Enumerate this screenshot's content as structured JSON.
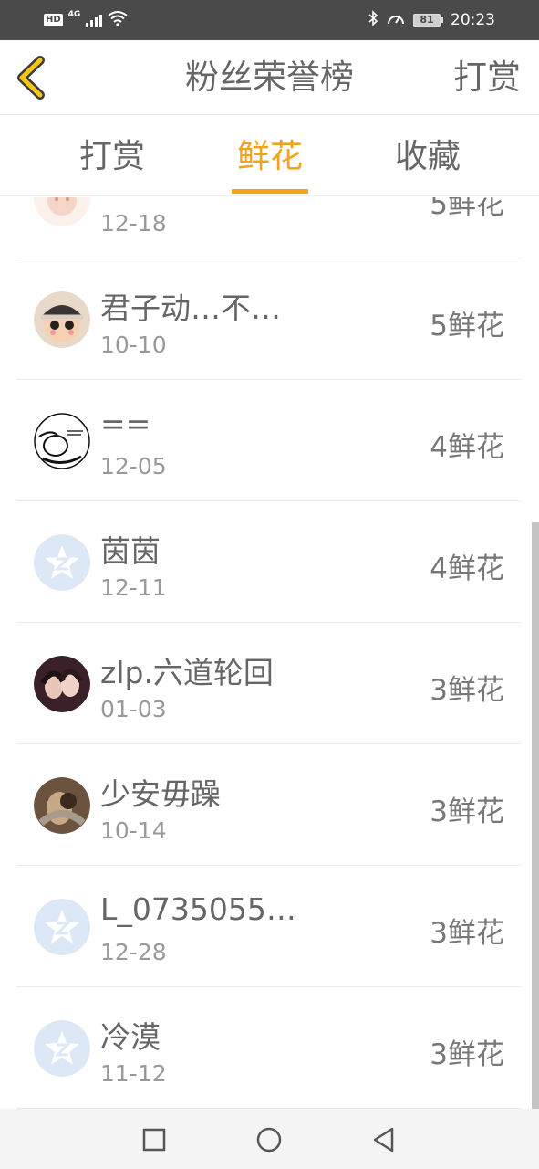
{
  "status_bar": {
    "hd": "HD",
    "network": "4G",
    "battery": "81",
    "time": "20:23"
  },
  "header": {
    "title": "粉丝荣誉榜",
    "action": "打赏"
  },
  "tabs": [
    {
      "label": "打赏",
      "active": false
    },
    {
      "label": "鲜花",
      "active": true
    },
    {
      "label": "收藏",
      "active": false
    }
  ],
  "fans": [
    {
      "name": "",
      "date": "12-18",
      "flowers": "5鲜花",
      "avatar": "doll-pink"
    },
    {
      "name": "君子动…不…",
      "date": "10-10",
      "flowers": "5鲜花",
      "avatar": "doll-hat"
    },
    {
      "name": "==",
      "date": "12-05",
      "flowers": "4鲜花",
      "avatar": "sketch"
    },
    {
      "name": "茵茵",
      "date": "12-11",
      "flowers": "4鲜花",
      "avatar": "qq-default"
    },
    {
      "name": "zlp.六道轮回",
      "date": "01-03",
      "flowers": "3鲜花",
      "avatar": "photo-girls"
    },
    {
      "name": "少安毋躁",
      "date": "10-14",
      "flowers": "3鲜花",
      "avatar": "photo-couple"
    },
    {
      "name": "L_0735055…",
      "date": "12-28",
      "flowers": "3鲜花",
      "avatar": "qq-default"
    },
    {
      "name": "冷漠",
      "date": "11-12",
      "flowers": "3鲜花",
      "avatar": "qq-default"
    }
  ],
  "nav": {
    "recents": "square-icon",
    "home": "circle-icon",
    "back": "triangle-icon"
  },
  "colors": {
    "accent": "#f2a31b",
    "status_bar": "#4a4a4a"
  }
}
